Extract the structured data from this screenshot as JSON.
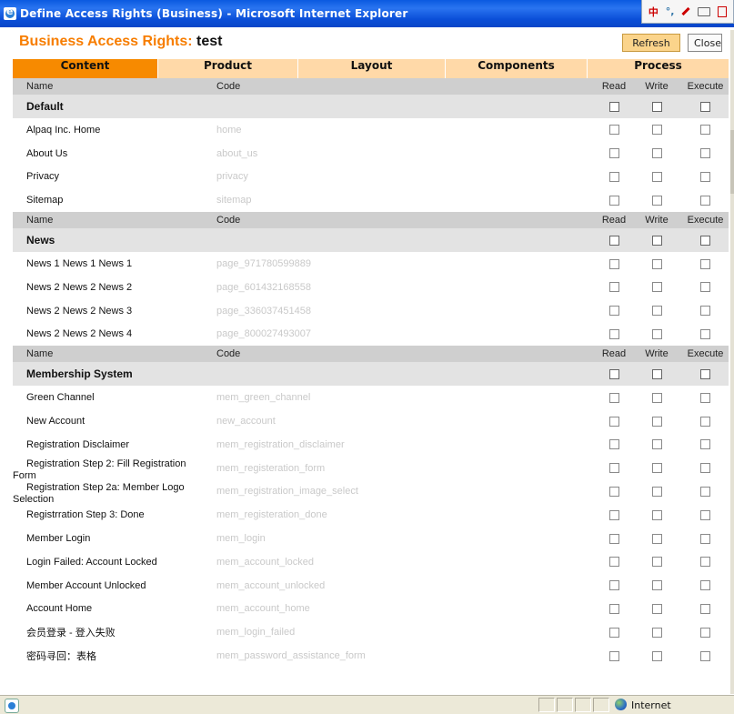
{
  "window": {
    "title": "Define Access Rights (Business) - Microsoft Internet Explorer",
    "icon": "ie-icon",
    "ime_bar": {
      "mode": "中",
      "punct": "°,",
      "icons": [
        "ime-mode-icon",
        "ime-punctuation-icon",
        "ime-handwriting-icon",
        "ime-keyboard-icon",
        "ime-menu-icon"
      ]
    }
  },
  "header": {
    "title_label": "Business Access Rights:",
    "title_name": "test",
    "refresh_label": "Refresh",
    "close_label": "Close"
  },
  "tabs": [
    {
      "label": "Content",
      "active": true
    },
    {
      "label": "Product",
      "active": false
    },
    {
      "label": "Layout",
      "active": false
    },
    {
      "label": "Components",
      "active": false
    },
    {
      "label": "Process",
      "active": false
    }
  ],
  "columns": {
    "name": "Name",
    "code": "Code",
    "read": "Read",
    "write": "Write",
    "execute": "Execute"
  },
  "groups": [
    {
      "name": "Default",
      "items": [
        {
          "name": "Alpaq Inc. Home",
          "code": "home"
        },
        {
          "name": "About Us",
          "code": "about_us"
        },
        {
          "name": "Privacy",
          "code": "privacy"
        },
        {
          "name": "Sitemap",
          "code": "sitemap"
        }
      ]
    },
    {
      "name": "News",
      "items": [
        {
          "name": "News 1 News 1 News 1",
          "code": "page_971780599889"
        },
        {
          "name": "News 2 News 2 News 2",
          "code": "page_601432168558"
        },
        {
          "name": "News 2 News 2 News 3",
          "code": "page_336037451458"
        },
        {
          "name": "News 2 News 2 News 4",
          "code": "page_800027493007"
        }
      ]
    },
    {
      "name": "Membership System",
      "items": [
        {
          "name": "Green Channel",
          "code": "mem_green_channel"
        },
        {
          "name": "New Account",
          "code": "new_account"
        },
        {
          "name": "Registration Disclaimer",
          "code": "mem_registration_disclaimer"
        },
        {
          "name": "Registration Step 2: Fill Registration Form",
          "code": "mem_registeration_form",
          "two_line": true
        },
        {
          "name": "Registration Step 2a: Member Logo Selection",
          "code": "mem_registration_image_select",
          "two_line": true
        },
        {
          "name": "Registrration Step 3: Done",
          "code": "mem_registeration_done"
        },
        {
          "name": "Member Login",
          "code": "mem_login"
        },
        {
          "name": "Login Failed: Account Locked",
          "code": "mem_account_locked"
        },
        {
          "name": "Member Account Unlocked",
          "code": "mem_account_unlocked"
        },
        {
          "name": "Account Home",
          "code": "mem_account_home"
        },
        {
          "name": "会员登录 - 登入失败",
          "code": "mem_login_failed"
        },
        {
          "name": "密码寻回：表格",
          "code": "mem_password_assistance_form"
        }
      ]
    }
  ],
  "status": {
    "zone_label": "Internet",
    "page_icon": "ie-page-icon",
    "zone_icon": "globe-icon"
  },
  "colors": {
    "accent": "#f78a00",
    "title_orange": "#f77d00",
    "tab_bg": "#ffd9a8",
    "column_header_bg": "#cfcfcf",
    "group_bg": "#e3e3e3",
    "code_text": "#c9c9c9"
  }
}
